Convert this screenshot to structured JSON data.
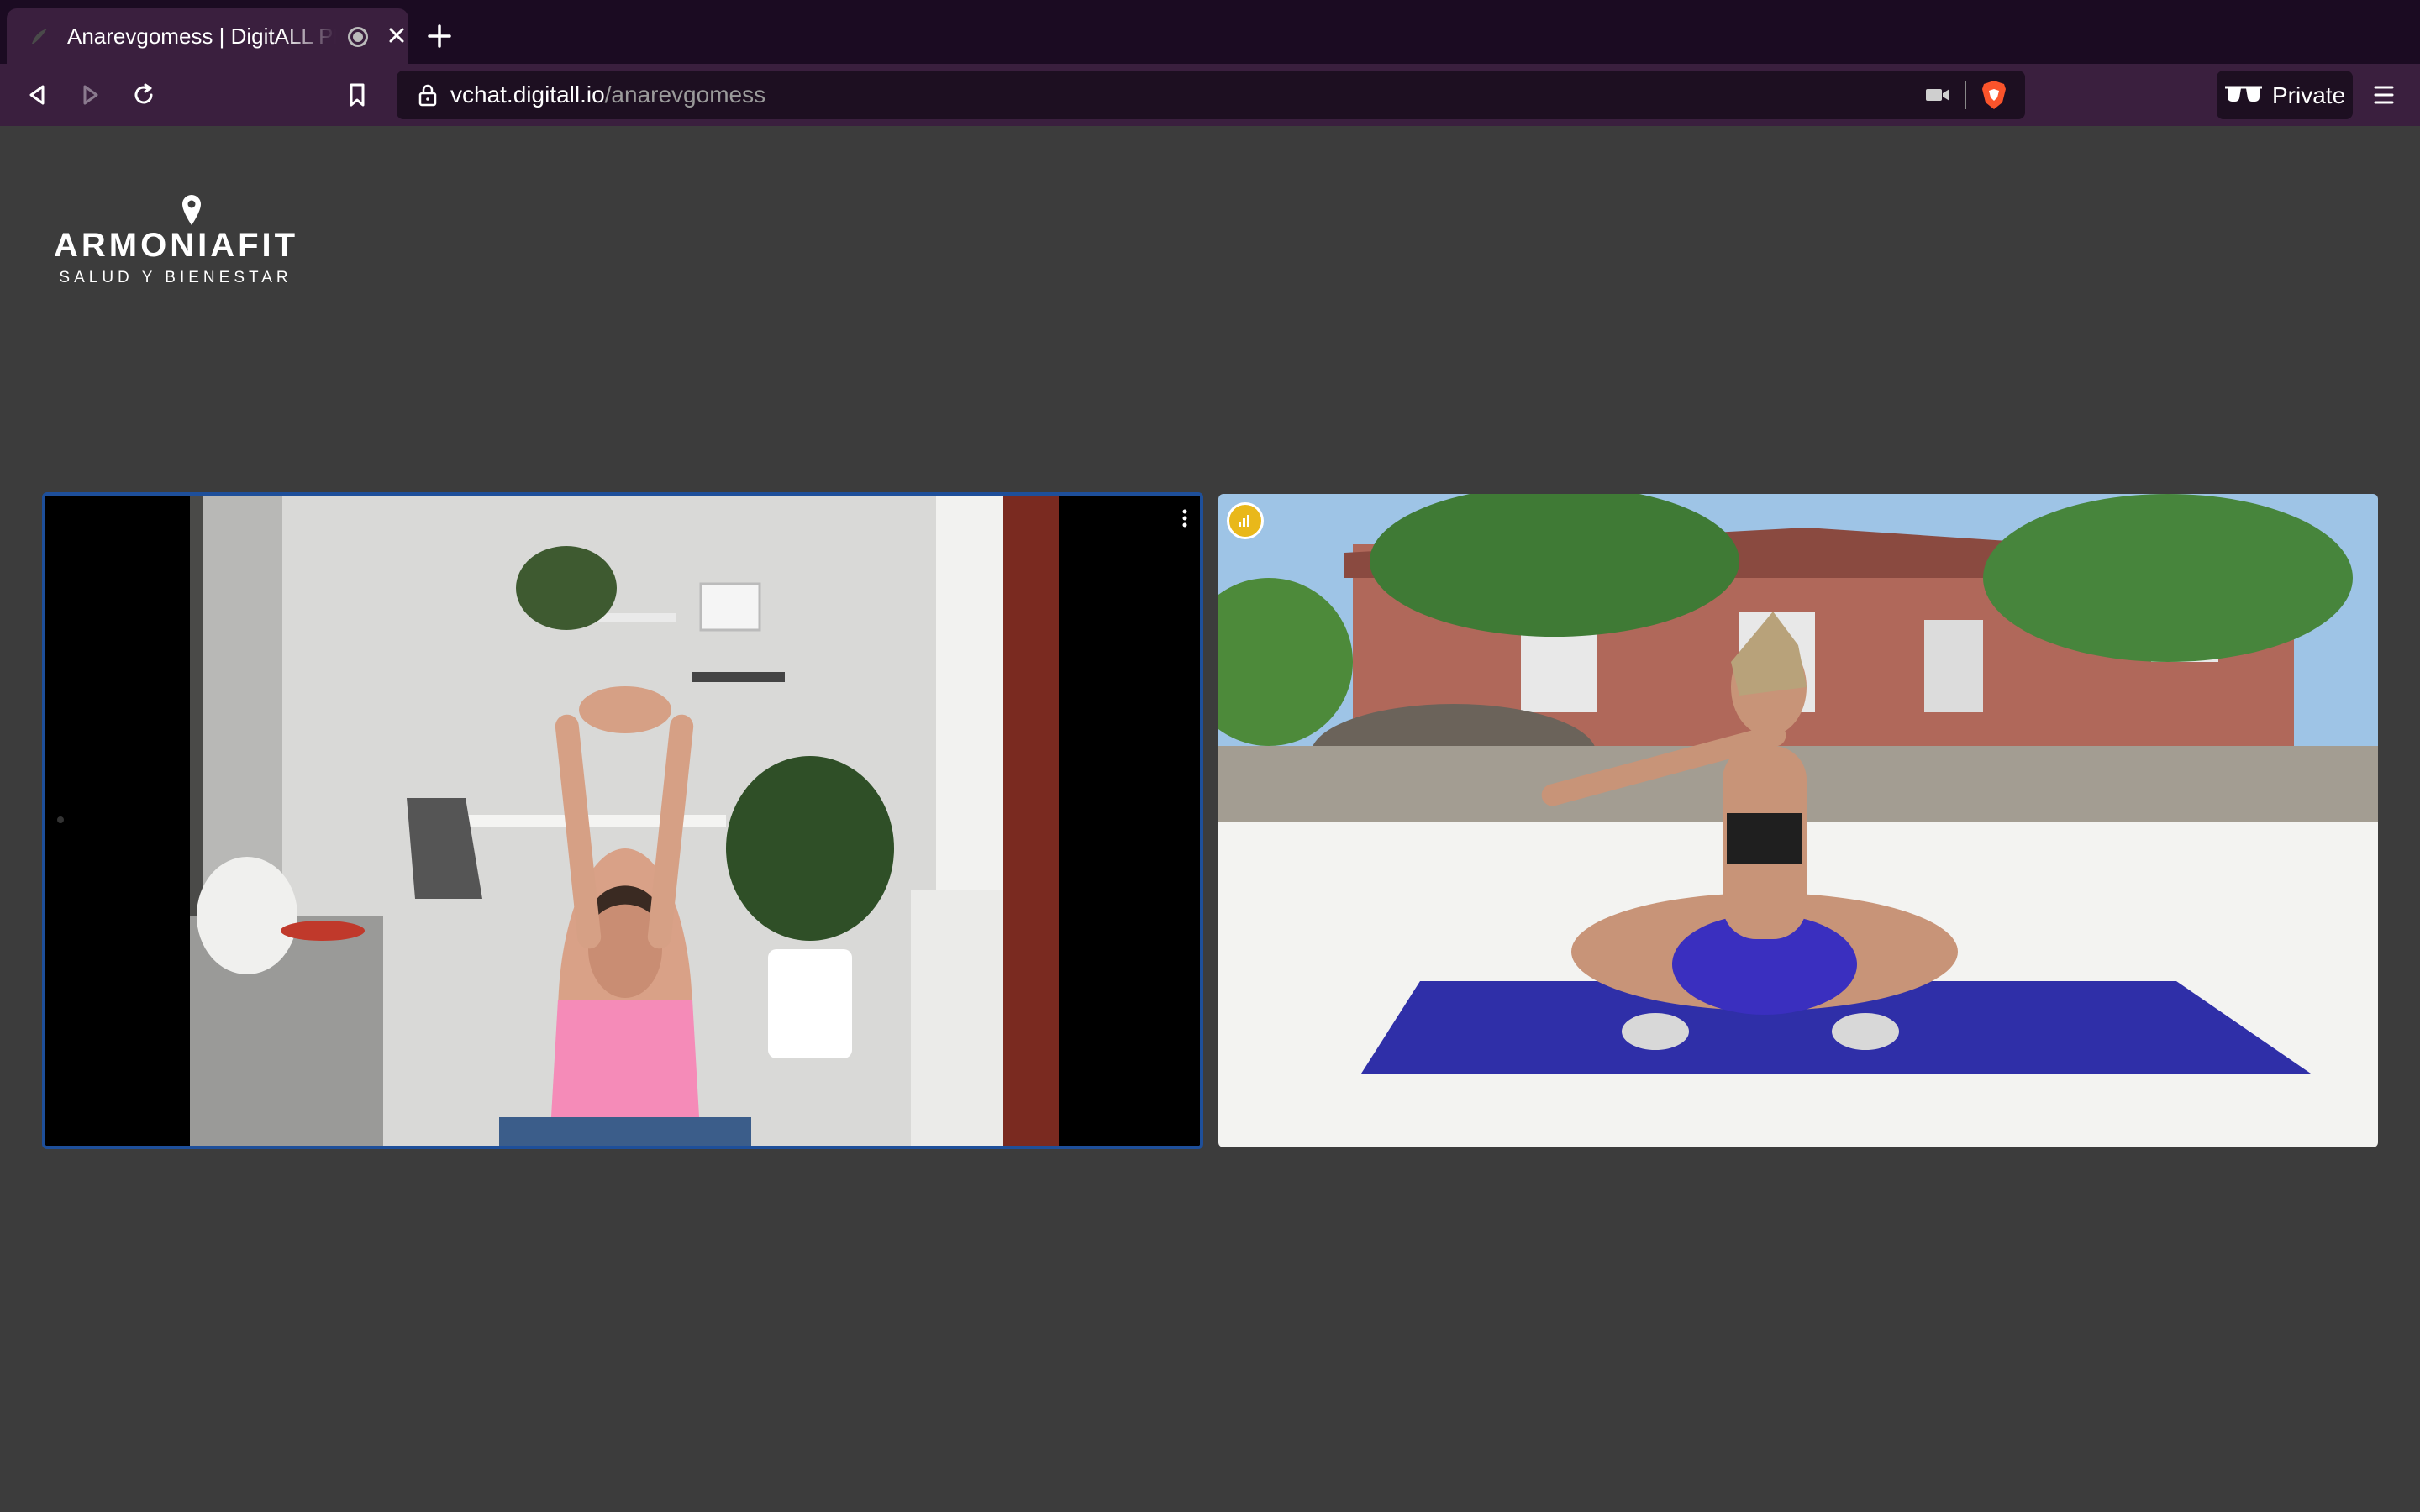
{
  "browser": {
    "tab": {
      "title": "Anarevgomess | DigitALL PR"
    },
    "url": {
      "host": "vchat.digitall.io",
      "path": "/anarevgomess"
    },
    "private_label": "Private"
  },
  "page": {
    "logo": {
      "title": "ARMONIAFIT",
      "subtitle": "SALUD Y BIENESTAR"
    }
  },
  "colors": {
    "tabbar_bg": "#1b0b22",
    "toolbar_bg": "#3a1f3e",
    "page_bg": "#3c3c3c",
    "active_speaker_border": "#1e4f9a",
    "network_badge": "#e9b81a"
  },
  "icons": {
    "back": "triangle-left-icon",
    "forward": "triangle-right-icon",
    "reload": "reload-icon",
    "bookmark": "bookmark-icon",
    "lock": "lock-icon",
    "camera": "camera-icon",
    "brave": "brave-shield-icon",
    "private": "private-glasses-icon",
    "menu": "hamburger-menu-icon",
    "tile_menu": "vertical-dots-icon",
    "network": "signal-bars-icon"
  }
}
